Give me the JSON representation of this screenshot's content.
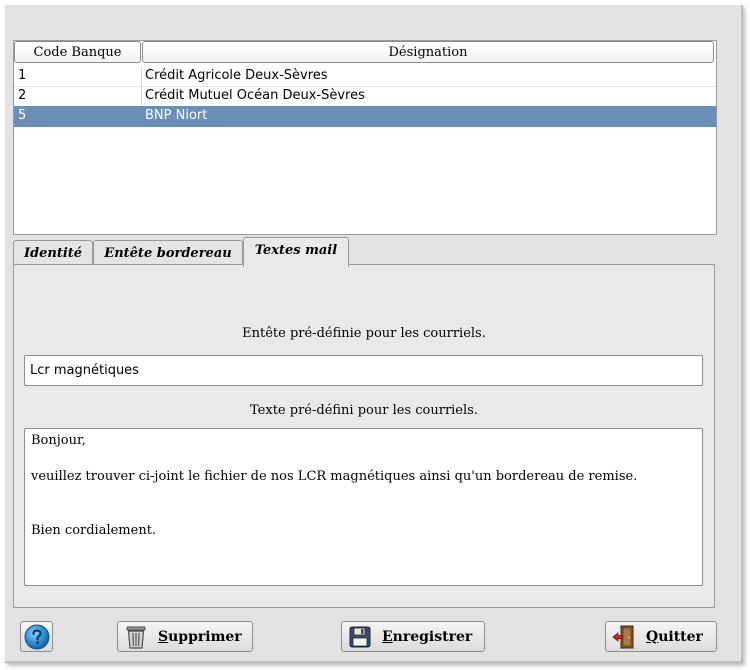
{
  "table": {
    "headers": {
      "code": "Code Banque",
      "designation": "Désignation"
    },
    "rows": [
      {
        "code": "1",
        "designation": "Crédit Agricole Deux-Sèvres",
        "selected": false
      },
      {
        "code": "2",
        "designation": "Crédit Mutuel Océan Deux-Sèvres",
        "selected": false
      },
      {
        "code": "5",
        "designation": "BNP Niort",
        "selected": true
      }
    ],
    "selection_color": "#6b8fb7"
  },
  "tabs": [
    {
      "label": "Identité",
      "active": false
    },
    {
      "label": "Entête bordereau",
      "active": false
    },
    {
      "label": "Textes mail",
      "active": true
    }
  ],
  "mail": {
    "subject_label": "Entête pré-définie pour les courriels.",
    "subject_value": "Lcr magnétiques",
    "body_label": "Texte pré-défini pour les courriels.",
    "body_lines": [
      "Bonjour,",
      "",
      "veuillez trouver ci-joint le fichier de nos LCR magnétiques ainsi qu'un bordereau de remise.",
      "",
      "",
      "Bien cordialement."
    ]
  },
  "toolbar": {
    "help_icon": "help-icon",
    "delete_label": "Supprimer",
    "delete_icon": "trash-icon",
    "save_label": "Enregistrer",
    "save_icon": "floppy-disk-icon",
    "quit_label": "Quitter",
    "quit_icon": "exit-door-icon"
  }
}
